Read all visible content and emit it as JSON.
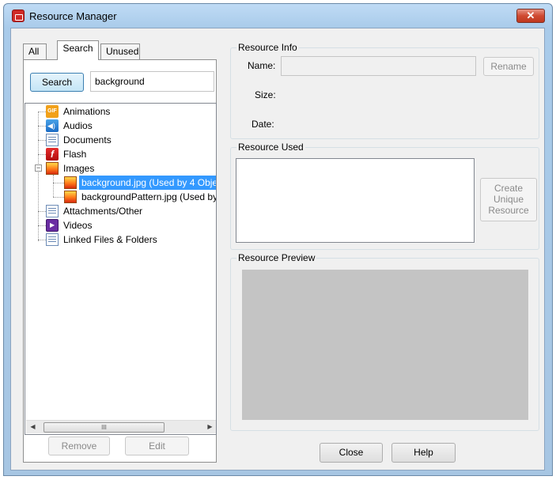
{
  "window": {
    "title": "Resource Manager",
    "close_glyph": "✕"
  },
  "tabs": [
    {
      "label": "All",
      "active": false
    },
    {
      "label": "Search",
      "active": true
    },
    {
      "label": "Unused",
      "active": false
    }
  ],
  "search": {
    "button_label": "Search",
    "query": "background"
  },
  "tree": {
    "items": [
      {
        "label": "Animations",
        "icon": "gif-icon"
      },
      {
        "label": "Audios",
        "icon": "audio-icon"
      },
      {
        "label": "Documents",
        "icon": "document-icon"
      },
      {
        "label": "Flash",
        "icon": "flash-icon"
      },
      {
        "label": "Images",
        "icon": "image-icon",
        "expanded": true,
        "children": [
          {
            "label": "background.jpg (Used by 4 Obje",
            "icon": "image-icon",
            "selected": true
          },
          {
            "label": "backgroundPattern.jpg (Used by",
            "icon": "image-icon"
          }
        ]
      },
      {
        "label": "Attachments/Other",
        "icon": "document-icon"
      },
      {
        "label": "Videos",
        "icon": "video-icon"
      },
      {
        "label": "Linked Files & Folders",
        "icon": "document-icon"
      }
    ],
    "expander_minus": "−",
    "scroll_left": "◀",
    "scroll_right": "▶",
    "scroll_grip": "III"
  },
  "left_buttons": {
    "remove": "Remove",
    "edit": "Edit"
  },
  "resource_info": {
    "title": "Resource Info",
    "name_label": "Name:",
    "name_value": "",
    "rename_button": "Rename",
    "size_label": "Size:",
    "date_label": "Date:"
  },
  "resource_used": {
    "title": "Resource Used",
    "create_button_lines": [
      "Create",
      "Unique",
      "Resource"
    ]
  },
  "resource_preview": {
    "title": "Resource Preview"
  },
  "bottom_buttons": {
    "close": "Close",
    "help": "Help"
  }
}
